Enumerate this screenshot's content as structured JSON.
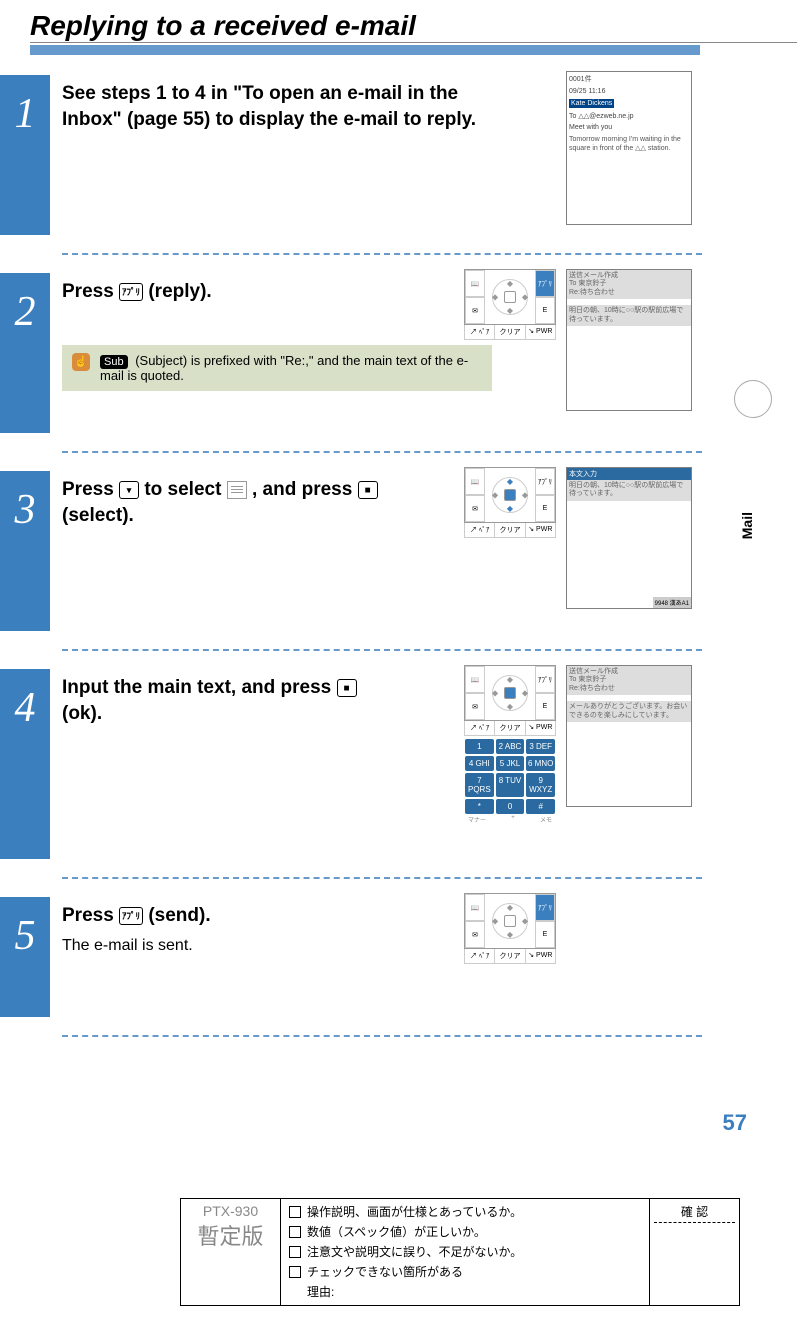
{
  "title": "Replying to a received e-mail",
  "side_tab": "Mail",
  "page_number": "57",
  "steps": [
    {
      "num": "1",
      "text": "See steps 1 to 4 in \"To open an e-mail in the Inbox\" (page 55) to display the e-mail to reply."
    },
    {
      "num": "2",
      "text_pre": "Press ",
      "key_label": "ｱﾌﾟﾘ",
      "text_post": " (reply).",
      "note_badge": "Sub",
      "note_text": "(Subject) is prefixed with \"Re:,\" and the main text of the e-mail is quoted."
    },
    {
      "num": "3",
      "text_pre": "Press ",
      "text_mid1": " to select ",
      "text_mid2": ", and press ",
      "text_post": " (select)."
    },
    {
      "num": "4",
      "text_pre": "Input the main text, and press ",
      "text_post": " (ok)."
    },
    {
      "num": "5",
      "text_pre": "Press ",
      "key_label": "ｱﾌﾟﾘ",
      "text_post": " (send).",
      "sub": "The e-mail is sent."
    }
  ],
  "keypad": {
    "left_icons": [
      "📖",
      "✉"
    ],
    "right_icons": [
      "ｱﾌﾟﾘ",
      "E"
    ],
    "bottom_row": [
      "↗ ﾍﾟｱ",
      "クリア",
      "↘ PWR"
    ],
    "numpad": [
      [
        "1",
        "2 ABC",
        "3 DEF"
      ],
      [
        "4 GHI",
        "5 JKL",
        "6 MNO"
      ],
      [
        "7 PQRS",
        "8 TUV",
        "9 WXYZ"
      ],
      [
        "*",
        "0",
        "#"
      ]
    ],
    "manner": "マナー",
    "memo": "メモ"
  },
  "screenshots": {
    "s1": {
      "header1": "0001件",
      "header2": "09/25 11:16",
      "from": "Kate Dickens",
      "to": "To △△@ezweb.ne.jp",
      "subject": "Meet with you",
      "body": "Tomorrow morning I'm waiting in the square in front of the △△ station."
    },
    "s2": {
      "title": "送信メール作成",
      "to": "To 東京鈴子",
      "subject": "Re:待ち合わせ",
      "body": "明日の朝、10時に○○駅の駅前広場で待っています。"
    },
    "s3": {
      "title": "本文入力",
      "body": "明日の朝、10時に○○駅の駅前広場で待っています。",
      "status": "9948 漢あA1"
    },
    "s4": {
      "title": "送信メール作成",
      "to": "To 東京鈴子",
      "subject": "Re:待ち合わせ",
      "body": "メールありがとうございます。お会いできるのを楽しみにしています。"
    }
  },
  "footer": {
    "model": "PTX-930",
    "provisional": "暫定版",
    "checks": [
      "操作説明、画面が仕様とあっているか。",
      "数値（スペック値）が正しいか。",
      "注意文や説明文に誤り、不足がないか。",
      "チェックできない箇所がある"
    ],
    "reason_label": "理由:",
    "confirm": "確 認"
  }
}
